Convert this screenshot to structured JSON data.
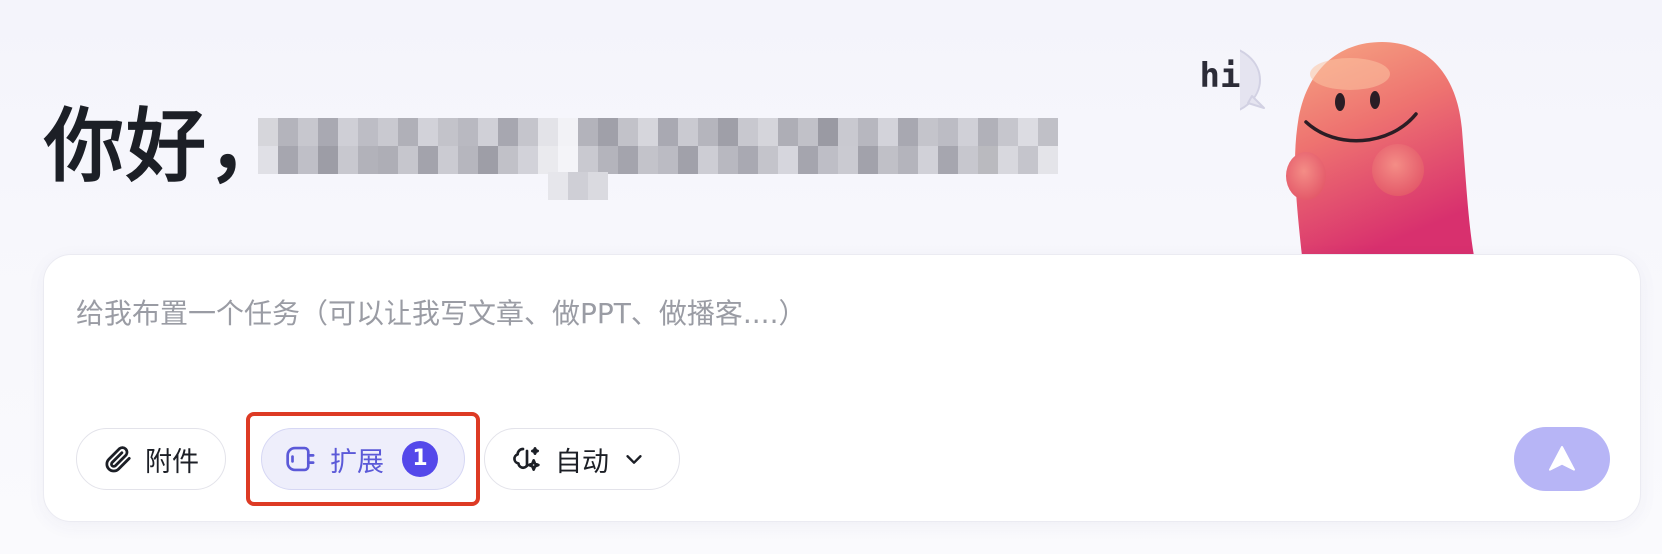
{
  "greeting": {
    "text": "你好，"
  },
  "mascot": {
    "speech": "hi"
  },
  "composer": {
    "placeholder": "给我布置一个任务（可以让我写文章、做PPT、做播客....）",
    "attach_label": "附件",
    "attach_icon": "paperclip-icon",
    "extensions_label": "扩展",
    "extensions_icon": "plug-icon",
    "extensions_count": "1",
    "mode_label": "自动",
    "mode_icon": "sparkle-brain-icon",
    "mode_chevron_icon": "chevron-down-icon",
    "send_icon": "send-arrow-icon"
  },
  "colors": {
    "accent": "#5448ea",
    "accent_soft": "#eeeefb",
    "send_disabled": "#b7b5f6",
    "highlight_box": "#dd3a24",
    "text_primary": "#1c1f26",
    "placeholder": "#9a9ca4"
  }
}
